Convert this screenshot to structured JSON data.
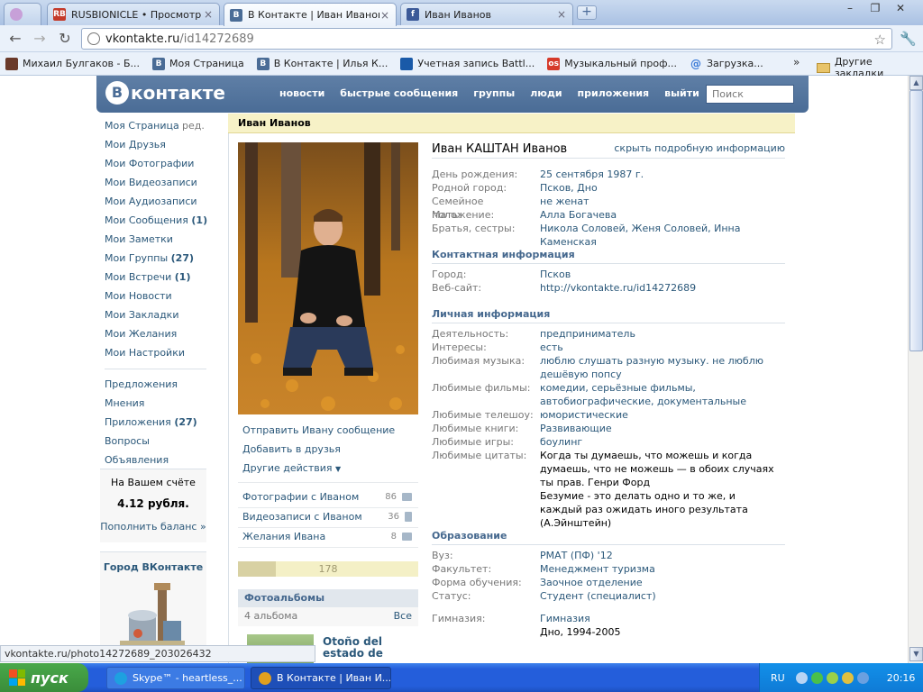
{
  "browser": {
    "tabs": [
      {
        "title": "",
        "icon": "app-icon",
        "color": "#c7a0d8"
      },
      {
        "title": "RUSBIONICLE • Просмотр ...",
        "icon": "rb-favicon",
        "color": "#c43a2a"
      },
      {
        "title": "В Контакте | Иван Иванов",
        "icon": "vk-favicon",
        "color": "#4a6c96"
      },
      {
        "title": "Иван Иванов",
        "icon": "facebook-favicon",
        "color": "#3b5998"
      }
    ],
    "url_host": "vkontakte.ru",
    "url_path": "/id14272689",
    "bookmarks": [
      {
        "label": "Михаил Булгаков - Б...",
        "color": "#6a3a2a"
      },
      {
        "label": "Моя Страница",
        "color": "#4a6c96"
      },
      {
        "label": "В Контакте | Илья К...",
        "color": "#4a6c96"
      },
      {
        "label": "Учетная запись Battl...",
        "color": "#1a5aa8"
      },
      {
        "label": "Музыкальный проф...",
        "color": "#d63a2a"
      },
      {
        "label": "Загрузка...",
        "color": "#3a7ad8"
      }
    ],
    "more_bookmarks": "»",
    "other_bookmarks": "Другие закладки",
    "status_url": "vkontakte.ru/photo14272689_203026432"
  },
  "vk": {
    "logo": "контакте",
    "logo_letter": "В",
    "nav": [
      "новости",
      "быстрые сообщения",
      "группы",
      "люди",
      "приложения",
      "выйти"
    ],
    "search_placeholder": "Поиск",
    "left_menu": [
      {
        "label": "Моя Страница",
        "count": ""
      },
      {
        "label": "Мои Друзья",
        "count": ""
      },
      {
        "label": "Мои Фотографии",
        "count": ""
      },
      {
        "label": "Мои Видеозаписи",
        "count": ""
      },
      {
        "label": "Мои Аудиозаписи",
        "count": ""
      },
      {
        "label": "Мои Сообщения",
        "count": "(1)"
      },
      {
        "label": "Мои Заметки",
        "count": ""
      },
      {
        "label": "Мои Группы",
        "count": "(27)"
      },
      {
        "label": "Мои Встречи",
        "count": "(1)"
      },
      {
        "label": "Мои Новости",
        "count": ""
      },
      {
        "label": "Мои Закладки",
        "count": ""
      },
      {
        "label": "Мои Желания",
        "count": ""
      },
      {
        "label": "Мои Настройки",
        "count": ""
      }
    ],
    "edit_label": "ред.",
    "left_menu2": [
      {
        "label": "Предложения",
        "count": ""
      },
      {
        "label": "Мнения",
        "count": ""
      },
      {
        "label": "Приложения",
        "count": "(27)"
      },
      {
        "label": "Вопросы",
        "count": ""
      },
      {
        "label": "Объявления",
        "count": ""
      }
    ],
    "balance_title": "На Вашем счёте",
    "balance_value": "4.12 рубля.",
    "balance_link": "Пополнить баланс »",
    "city_title": "Город ВКонтакте"
  },
  "profile": {
    "header_name": "Иван Иванов",
    "full_name": "Иван КАШТАН Иванов",
    "hide_link": "скрыть подробную информацию",
    "actions": [
      "Отправить Ивану сообщение",
      "Добавить в друзья",
      "Другие действия"
    ],
    "media": [
      {
        "label": "Фотографии с Иваном",
        "count": "86"
      },
      {
        "label": "Видеозаписи с Иваном",
        "count": "36"
      },
      {
        "label": "Желания Ивана",
        "count": "8"
      }
    ],
    "rating": "178",
    "rating_fill": 0.21,
    "albums_title": "Фотоальбомы",
    "albums_count": "4 альбома",
    "albums_all": "Все",
    "album_title": "Otoño del estado de",
    "basic": [
      {
        "label": "День рождения:",
        "value": "25 сентября 1987 г."
      },
      {
        "label": "Родной город:",
        "value": "Псков, Дно"
      },
      {
        "label": "Семейное положение:",
        "value": "не женат"
      },
      {
        "label": "Мать:",
        "value": "Алла Богачева"
      },
      {
        "label": "Братья, сестры:",
        "value": "Никола Соловей, Женя Соловей, Инна Каменская"
      }
    ],
    "contact_title": "Контактная информация",
    "contact": [
      {
        "label": "Город:",
        "value": "Псков"
      },
      {
        "label": "Веб-сайт:",
        "value": "http://vkontakte.ru/id14272689"
      }
    ],
    "personal_title": "Личная информация",
    "personal": [
      {
        "label": "Деятельность:",
        "value": "предприниматель"
      },
      {
        "label": "Интересы:",
        "value": "есть"
      },
      {
        "label": "Любимая музыка:",
        "value": "люблю слушать разную музыку. не люблю дешёвую попсу"
      },
      {
        "label": "Любимые фильмы:",
        "value": "комедии, серьёзные фильмы, автобиографические, документальные"
      },
      {
        "label": "Любимые телешоу:",
        "value": "юмористические"
      },
      {
        "label": "Любимые книги:",
        "value": "Развивающие"
      },
      {
        "label": "Любимые игры:",
        "value": "боулинг"
      },
      {
        "label": "Любимые цитаты:",
        "value": "Когда ты думаешь, что можешь и когда думаешь, что не можешь — в обоих случаях ты прав. Генри Форд"
      },
      {
        "label": "",
        "value": "Безумие - это делать одно и то же, и каждый раз ожидать иного результата (А.Эйнштейн)"
      }
    ],
    "edu_title": "Образование",
    "edu": [
      {
        "label": "Вуз:",
        "value": "РМАТ (ПФ) '12"
      },
      {
        "label": "Факультет:",
        "value": "Менеджмент туризма"
      },
      {
        "label": "Форма обучения:",
        "value": "Заочное отделение"
      },
      {
        "label": "Статус:",
        "value": "Студент (специалист)"
      },
      {
        "label": "Гимназия:",
        "value": "Гимназия"
      },
      {
        "label": "",
        "value": "Дно, 1994-2005"
      }
    ]
  },
  "taskbar": {
    "start": "пуск",
    "tasks": [
      {
        "label": "Skype™ - heartless_...",
        "color": "#1ea0e0"
      },
      {
        "label": "В Контакте | Иван И...",
        "color": "#e0a020"
      }
    ],
    "lang": "RU",
    "clock": "20:16"
  }
}
